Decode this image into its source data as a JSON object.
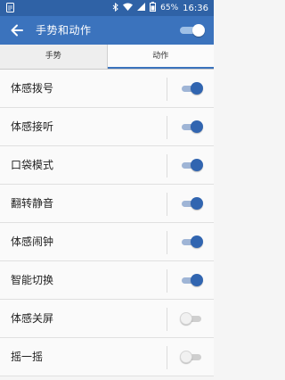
{
  "status_bar": {
    "battery_percent": "65%",
    "time": "16:36"
  },
  "toolbar": {
    "title": "手势和动作",
    "master_toggle_on": true
  },
  "tabs": [
    {
      "label": "手势",
      "active": false
    },
    {
      "label": "动作",
      "active": true
    }
  ],
  "settings": [
    {
      "label": "体感拨号",
      "enabled": true
    },
    {
      "label": "体感接听",
      "enabled": true
    },
    {
      "label": "口袋模式",
      "enabled": true
    },
    {
      "label": "翻转静音",
      "enabled": true
    },
    {
      "label": "体感闹钟",
      "enabled": true
    },
    {
      "label": "智能切换",
      "enabled": true
    },
    {
      "label": "体感关屏",
      "enabled": false
    },
    {
      "label": "摇一摇",
      "enabled": false
    }
  ],
  "colors": {
    "toolbar": "#3b73bd",
    "statusbar": "#2f62a6",
    "switch_on": "#3165b0"
  }
}
